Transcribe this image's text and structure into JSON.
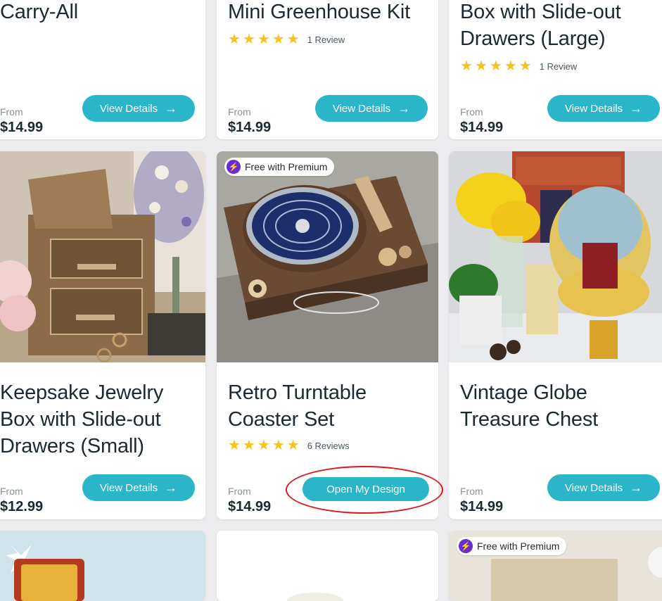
{
  "cards": [
    {
      "title_lines": [
        "Carry-All"
      ],
      "from_label": "From",
      "price": "$14.99",
      "button": "View Details"
    },
    {
      "title_lines": [
        "Mini Greenhouse Kit"
      ],
      "review_text": "1 Review",
      "from_label": "From",
      "price": "$14.99",
      "button": "View Details"
    },
    {
      "title_lines": [
        "Box with Slide-out",
        "Drawers (Large)"
      ],
      "review_text": "1 Review",
      "from_label": "From",
      "price": "$14.99",
      "button": "View Details"
    },
    {
      "title_lines": [
        "Keepsake Jewelry",
        "Box with Slide-out",
        "Drawers (Small)"
      ],
      "from_label": "From",
      "price": "$12.99",
      "button": "View Details"
    },
    {
      "badge": "Free with Premium",
      "title_lines": [
        "Retro Turntable",
        "Coaster Set"
      ],
      "review_text": "6 Reviews",
      "from_label": "From",
      "price": "$14.99",
      "button": "Open My Design"
    },
    {
      "title_lines": [
        "Vintage Globe",
        "Treasure Chest"
      ],
      "from_label": "From",
      "price": "$14.99",
      "button": "View Details"
    },
    {},
    {},
    {
      "badge": "Free with Premium"
    }
  ],
  "icons": {
    "arrow": "arrow-right-icon",
    "star": "star-icon",
    "bolt": "lightning-bolt-icon"
  },
  "colors": {
    "button": "#2bb5c9",
    "star": "#f7c21b",
    "premium": "#6a2ccf",
    "annotation": "#e0141b"
  }
}
